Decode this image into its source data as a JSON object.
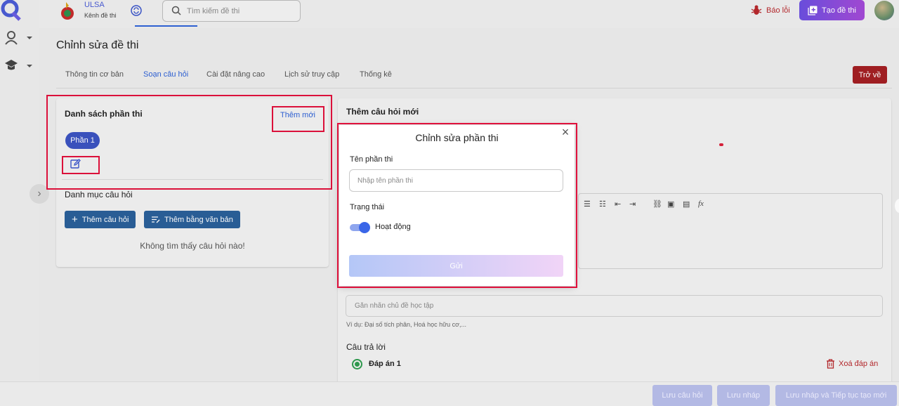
{
  "app": {
    "brand_name": "ULSA",
    "brand_sub": "Kênh đề thi",
    "search_placeholder": "Tìm kiếm đề thi",
    "report_label": "Báo lỗi",
    "create_label": "Tạo đề thi"
  },
  "page": {
    "title": "Chỉnh sửa đề thi",
    "back_label": "Trở về",
    "tabs": [
      {
        "label": "Thông tin cơ bản"
      },
      {
        "label": "Soạn câu hỏi"
      },
      {
        "label": "Cài đặt nâng cao"
      },
      {
        "label": "Lịch sử truy cập"
      },
      {
        "label": "Thống kê"
      }
    ],
    "active_tab": "Soạn câu hỏi"
  },
  "left": {
    "sections_title": "Danh sách phần thi",
    "add_new_label": "Thêm mới",
    "section_pill": "Phần 1",
    "categories_title": "Danh mục câu hỏi",
    "add_question_label": "Thêm câu hỏi",
    "add_text_label": "Thêm bằng văn bản",
    "empty_text": "Không tìm thấy câu hỏi nào!"
  },
  "right": {
    "title": "Thêm câu hỏi mới",
    "tag_placeholder": "Gắn nhãn chủ đề học tập",
    "hint": "Ví dụ: Đại số tích phân, Hoá học hữu cơ,...",
    "answers_title": "Câu trả lời",
    "answer_1": "Đáp án 1",
    "delete_answer_label": "Xoá đáp án"
  },
  "footer": {
    "save_question": "Lưu câu hỏi",
    "save_draft": "Lưu nháp",
    "save_continue": "Lưu nháp và Tiếp tục tạo mới"
  },
  "modal": {
    "title": "Chỉnh sửa phần thi",
    "name_label": "Tên phần thi",
    "name_placeholder": "Nhập tên phần thi",
    "status_label": "Trạng thái",
    "status_value": "Hoạt động",
    "status_on": true,
    "submit_label": "Gửi"
  },
  "colors": {
    "accent": "#2f62d6",
    "highlight": "#e0113c",
    "danger": "#a31f23",
    "primary_button": "#2a5f98"
  }
}
